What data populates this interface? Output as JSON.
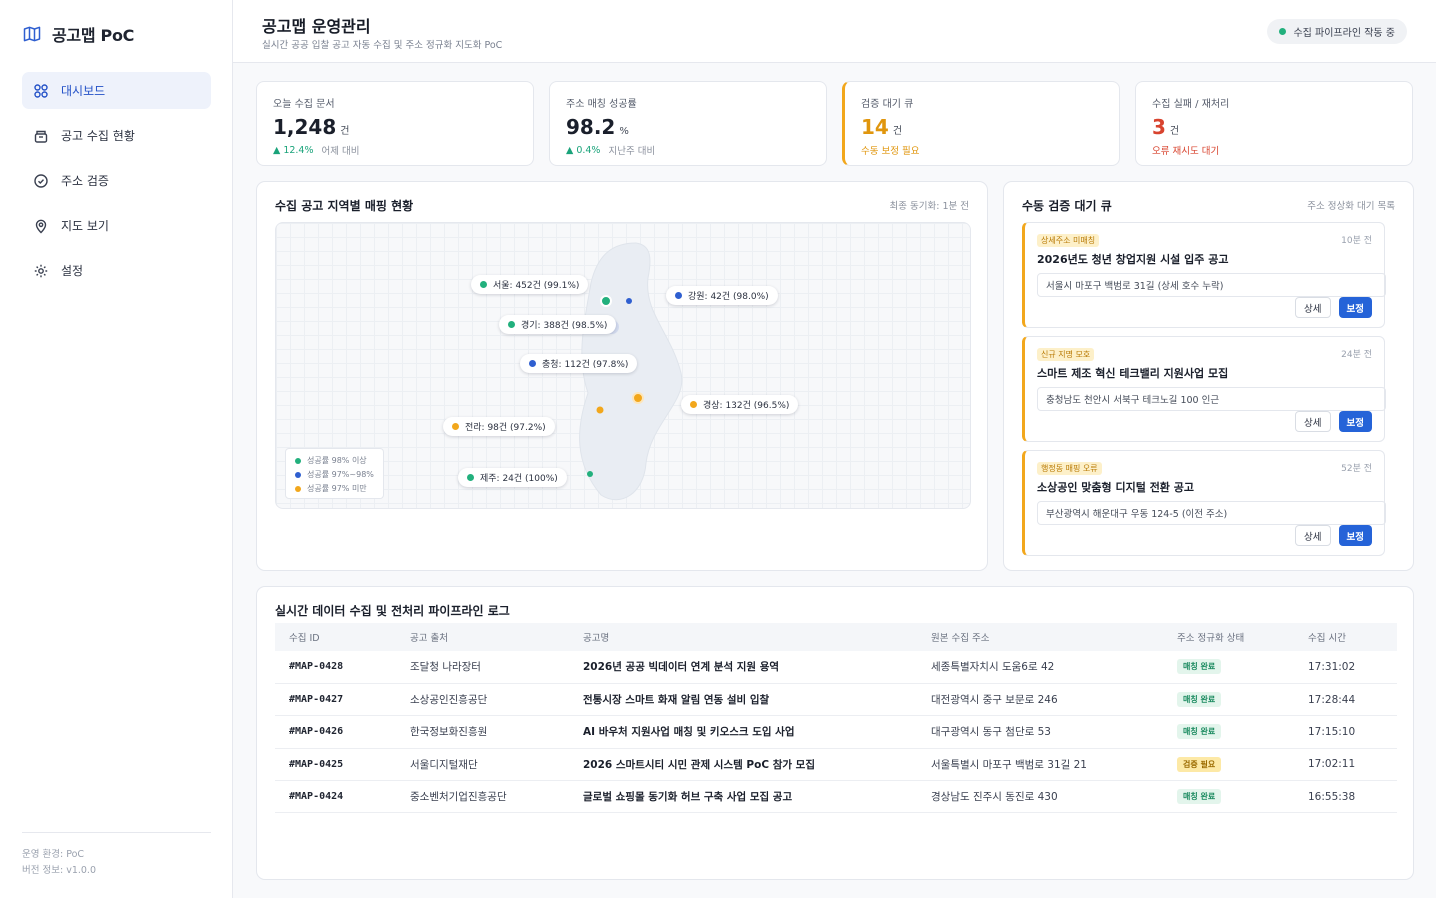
{
  "app": {
    "brand": "공고맵 PoC"
  },
  "sidebar": {
    "items": [
      {
        "label": "대시보드",
        "icon": "dashboard-icon"
      },
      {
        "label": "공고 수집 현황",
        "icon": "archive-icon"
      },
      {
        "label": "주소 검증",
        "icon": "check-circle-icon"
      },
      {
        "label": "지도 보기",
        "icon": "map-pin-icon"
      },
      {
        "label": "설정",
        "icon": "gear-icon"
      }
    ],
    "footer": {
      "env": "운영 환경: PoC",
      "version": "버전 정보: v1.0.0"
    }
  },
  "header": {
    "title": "공고맵 운영관리",
    "subtitle": "실시간 공공 입찰 공고 자동 수집 및 주소 정규화 지도화 PoC",
    "status": "수집 파이프라인 작동 중"
  },
  "kpis": [
    {
      "label": "오늘 수집 문서",
      "value": "1,248",
      "unit": "건",
      "delta": "▲ 12.4%",
      "note": "어제 대비"
    },
    {
      "label": "주소 매칭 성공률",
      "value": "98.2",
      "unit": "%",
      "delta": "▲ 0.4%",
      "note": "지난주 대비"
    },
    {
      "label": "검증 대기 큐",
      "value": "14",
      "unit": "건",
      "note": "수동 보정 필요"
    },
    {
      "label": "수집 실패 / 재처리",
      "value": "3",
      "unit": "건",
      "note": "오류 재시도 대기"
    }
  ],
  "map_panel": {
    "title": "수집 공고 지역별 매핑 현황",
    "meta": "최종 동기화: 1분 전",
    "regions": [
      {
        "label": "서울: 452건 (99.1%)",
        "color": "#22b07d"
      },
      {
        "label": "강원: 42건 (98.0%)",
        "color": "#2f5fd0"
      },
      {
        "label": "경기: 388건 (98.5%)",
        "color": "#22b07d"
      },
      {
        "label": "충청: 112건 (97.8%)",
        "color": "#2f5fd0"
      },
      {
        "label": "경상: 132건 (96.5%)",
        "color": "#f2a71c"
      },
      {
        "label": "전라: 98건 (97.2%)",
        "color": "#f2a71c"
      },
      {
        "label": "제주: 24건 (100%)",
        "color": "#22b07d"
      }
    ],
    "legend": [
      {
        "label": "성공률 98% 이상",
        "color": "#22b07d"
      },
      {
        "label": "성공률 97%~98%",
        "color": "#2f5fd0"
      },
      {
        "label": "성공률 97% 미만",
        "color": "#f2a71c"
      }
    ]
  },
  "queue_panel": {
    "title": "수동 검증 대기 큐",
    "meta": "주소 정상화 대기 목록",
    "detail_label": "상세",
    "fix_label": "보정",
    "items": [
      {
        "badge": "상세주소 미매칭",
        "time": "10분 전",
        "title": "2026년도 청년 창업지원 시설 입주 공고",
        "address": "서울시 마포구 백범로 31길 (상세 호수 누락)"
      },
      {
        "badge": "신규 지명 모호",
        "time": "24분 전",
        "title": "스마트 제조 혁신 테크밸리 지원사업 모집",
        "address": "충청남도 천안시 서북구 테크노길 100 인근"
      },
      {
        "badge": "행정동 매핑 오류",
        "time": "52분 전",
        "title": "소상공인 맞춤형 디지털 전환 공고",
        "address": "부산광역시 해운대구 우동 124-5 (이전 주소)"
      }
    ]
  },
  "log_panel": {
    "title": "실시간 데이터 수집 및 전처리 파이프라인 로그",
    "columns": [
      "수집 ID",
      "공고 출처",
      "공고명",
      "원본 수집 주소",
      "주소 정규화 상태",
      "수집 시간"
    ],
    "rows": [
      {
        "id": "#MAP-0428",
        "source": "조달청 나라장터",
        "name": "2026년 공공 빅데이터 연계 분석 지원 용역",
        "address": "세종특별자치시 도움6로 42",
        "status": "매칭 완료",
        "time": "17:31:02"
      },
      {
        "id": "#MAP-0427",
        "source": "소상공인진흥공단",
        "name": "전통시장 스마트 화재 알림 연동 설비 입찰",
        "address": "대전광역시 중구 보문로 246",
        "status": "매칭 완료",
        "time": "17:28:44"
      },
      {
        "id": "#MAP-0426",
        "source": "한국정보화진흥원",
        "name": "AI 바우처 지원사업 매칭 및 키오스크 도입 사업",
        "address": "대구광역시 동구 첨단로 53",
        "status": "매칭 완료",
        "time": "17:15:10"
      },
      {
        "id": "#MAP-0425",
        "source": "서울디지털재단",
        "name": "2026 스마트시티 시민 관제 시스템 PoC 참가 모집",
        "address": "서울특별시 마포구 백범로 31길 21",
        "status": "검증 필요",
        "time": "17:02:11"
      },
      {
        "id": "#MAP-0424",
        "source": "중소벤처기업진흥공단",
        "name": "글로벌 쇼핑몰 동기화 허브 구축 사업 모집 공고",
        "address": "경상남도 진주시 동진로 430",
        "status": "매칭 완료",
        "time": "16:55:38"
      }
    ]
  }
}
